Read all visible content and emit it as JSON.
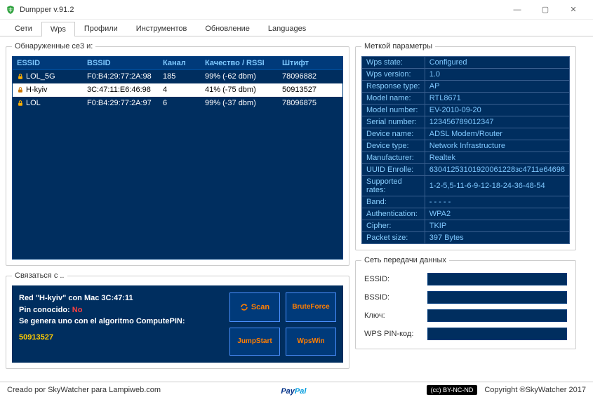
{
  "window": {
    "title": "Dumpper v.91.2"
  },
  "tabs": [
    "Сети",
    "Wps",
    "Профили",
    "Инструментов",
    "Обновление",
    "Languages"
  ],
  "active_tab": 1,
  "networks": {
    "legend": "Обнаруженные се3 и:",
    "headers": {
      "essid": "ESSID",
      "bssid": "BSSID",
      "chan": "Канал",
      "qual": "Качество / RSSI",
      "pin": "Штифт"
    },
    "rows": [
      {
        "essid": "LOL_5G",
        "bssid": "F0:B4:29:77:2A:98",
        "chan": "185",
        "qual": "99% (-62 dbm)",
        "pin": "78096882",
        "sel": false
      },
      {
        "essid": "H-kyiv",
        "bssid": "3C:47:11:E6:46:98",
        "chan": "4",
        "qual": "41% (-75 dbm)",
        "pin": "50913527",
        "sel": true
      },
      {
        "essid": "LOL",
        "bssid": "F0:B4:29:77:2A:97",
        "chan": "6",
        "qual": "99% (-37 dbm)",
        "pin": "78096875",
        "sel": false
      }
    ]
  },
  "details": {
    "legend": "Меткой параметры",
    "rows": [
      [
        "Wps state:",
        "Configured"
      ],
      [
        "Wps version:",
        "1.0"
      ],
      [
        "Response type:",
        "AP"
      ],
      [
        "Model name:",
        "RTL8671"
      ],
      [
        "Model number:",
        "EV-2010-09-20"
      ],
      [
        "Serial number:",
        "123456789012347"
      ],
      [
        "Device name:",
        "ADSL Modem/Router"
      ],
      [
        "Device type:",
        "Network Infrastructure"
      ],
      [
        "Manufacturer:",
        "Realtek"
      ],
      [
        "UUID Enrolle:",
        "63041253101920061228зc4711e64698"
      ],
      [
        "Supported rates:",
        "1-2-5,5-11-6-9-12-18-24-36-48-54"
      ],
      [
        "Band:",
        "- - - - -"
      ],
      [
        "Authentication:",
        "WPA2"
      ],
      [
        "Cipher:",
        "TKIP"
      ],
      [
        "Packet size:",
        "397 Bytes"
      ]
    ]
  },
  "connect": {
    "legend": "Связаться с ..",
    "line1a": "Red \"H-kyiv\" con Mac 3C:47:11",
    "line2a": "Pin conocido:",
    "line2b": "No",
    "line3": "Se genera uno con el algoritmo ComputePIN:",
    "pin": "50913527",
    "btn_scan": "Scan",
    "btn_brute": "BruteForce",
    "btn_jump": "JumpStart",
    "btn_wps": "WpsWin"
  },
  "netinfo": {
    "legend": "Сеть передачи данных",
    "essid": "ESSID:",
    "bssid": "BSSID:",
    "key": "Ключ:",
    "wpspin": "WPS PIN-код:"
  },
  "footer": {
    "left": "Creado por SkyWatcher para Lampiweb.com",
    "cc": "(cc) BY-NC-ND",
    "right": "Copyright ®SkyWatcher 2017"
  }
}
